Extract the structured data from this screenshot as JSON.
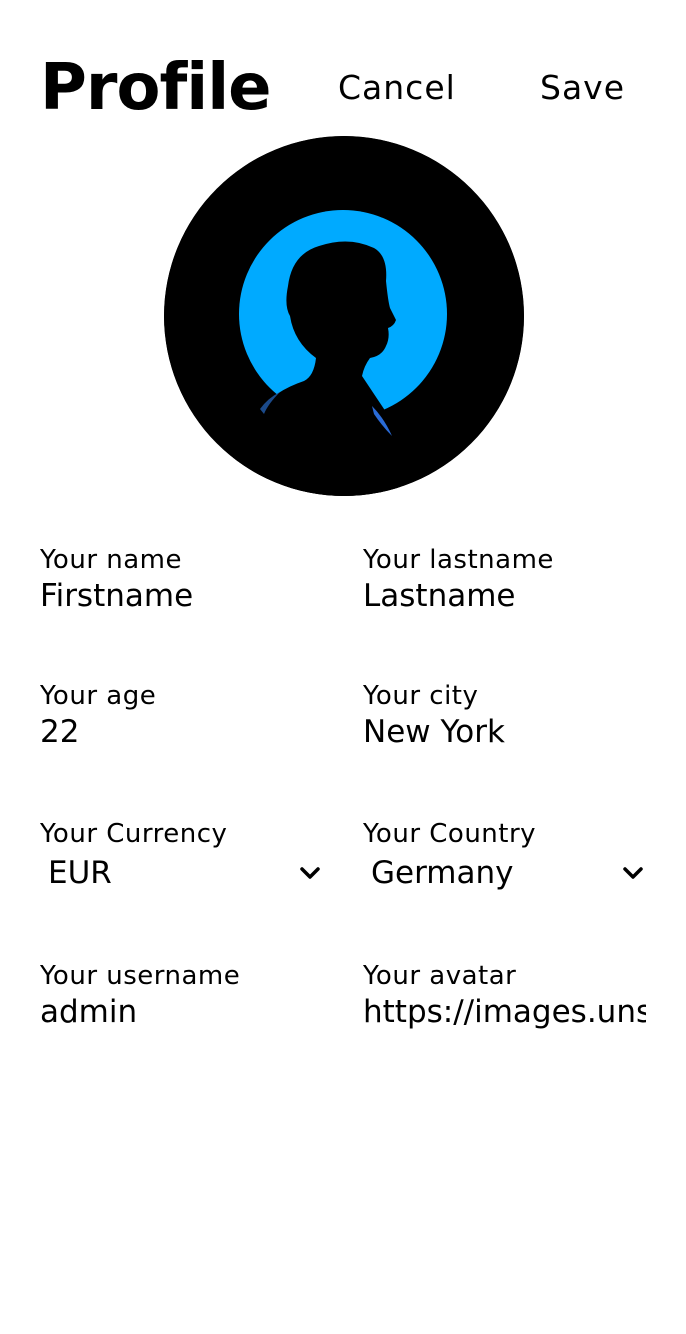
{
  "header": {
    "title": "Profile",
    "cancel_label": "Cancel",
    "save_label": "Save"
  },
  "avatar": {
    "icon": "avatar-silhouette",
    "ring_color": "#00aaff",
    "background_color": "#000000"
  },
  "form": {
    "name": {
      "label": "Your name",
      "value": "Firstname"
    },
    "lastname": {
      "label": "Your lastname",
      "value": "Lastname"
    },
    "age": {
      "label": "Your age",
      "value": "22"
    },
    "city": {
      "label": "Your city",
      "value": "New York"
    },
    "currency": {
      "label": "Your Currency",
      "value": "EUR",
      "icon": "chevron-down-icon"
    },
    "country": {
      "label": "Your Country",
      "value": "Germany",
      "icon": "chevron-down-icon"
    },
    "username": {
      "label": "Your username",
      "value": "admin"
    },
    "avatar_url": {
      "label": "Your avatar",
      "value": "https://images.unsp"
    }
  }
}
